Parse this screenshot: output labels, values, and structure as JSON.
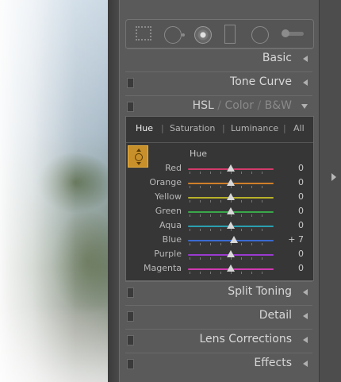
{
  "sections": {
    "basic": "Basic",
    "tone_curve": "Tone Curve",
    "split_toning": "Split Toning",
    "detail": "Detail",
    "lens_corrections": "Lens Corrections",
    "effects": "Effects"
  },
  "hsl_header": {
    "hsl": "HSL",
    "sep": "/",
    "color": "Color",
    "bw": "B&W"
  },
  "tabs": [
    "Hue",
    "Saturation",
    "Luminance",
    "All"
  ],
  "active_tab": "Hue",
  "group_label": "Hue",
  "sliders": [
    {
      "label": "Red",
      "value": "0",
      "pos": 0.5,
      "track": "#d23a6a"
    },
    {
      "label": "Orange",
      "value": "0",
      "pos": 0.5,
      "track": "#d0802a"
    },
    {
      "label": "Yellow",
      "value": "0",
      "pos": 0.5,
      "track": "#b8b22a"
    },
    {
      "label": "Green",
      "value": "0",
      "pos": 0.5,
      "track": "#3aa84a"
    },
    {
      "label": "Aqua",
      "value": "0",
      "pos": 0.5,
      "track": "#2aa0b0"
    },
    {
      "label": "Blue",
      "value": "+ 7",
      "pos": 0.535,
      "track": "#3a6ad0"
    },
    {
      "label": "Purple",
      "value": "0",
      "pos": 0.5,
      "track": "#9a3ad0"
    },
    {
      "label": "Magenta",
      "value": "0",
      "pos": 0.5,
      "track": "#d03ab0"
    }
  ],
  "icons": {
    "tools": [
      "crop-overlay-icon",
      "spot-removal-icon",
      "red-eye-icon",
      "graduated-filter-icon",
      "radial-filter-icon",
      "adjustment-brush-icon"
    ],
    "target": "targeted-adjustment-icon",
    "panel_arrow": "expand-right-arrow-icon"
  }
}
